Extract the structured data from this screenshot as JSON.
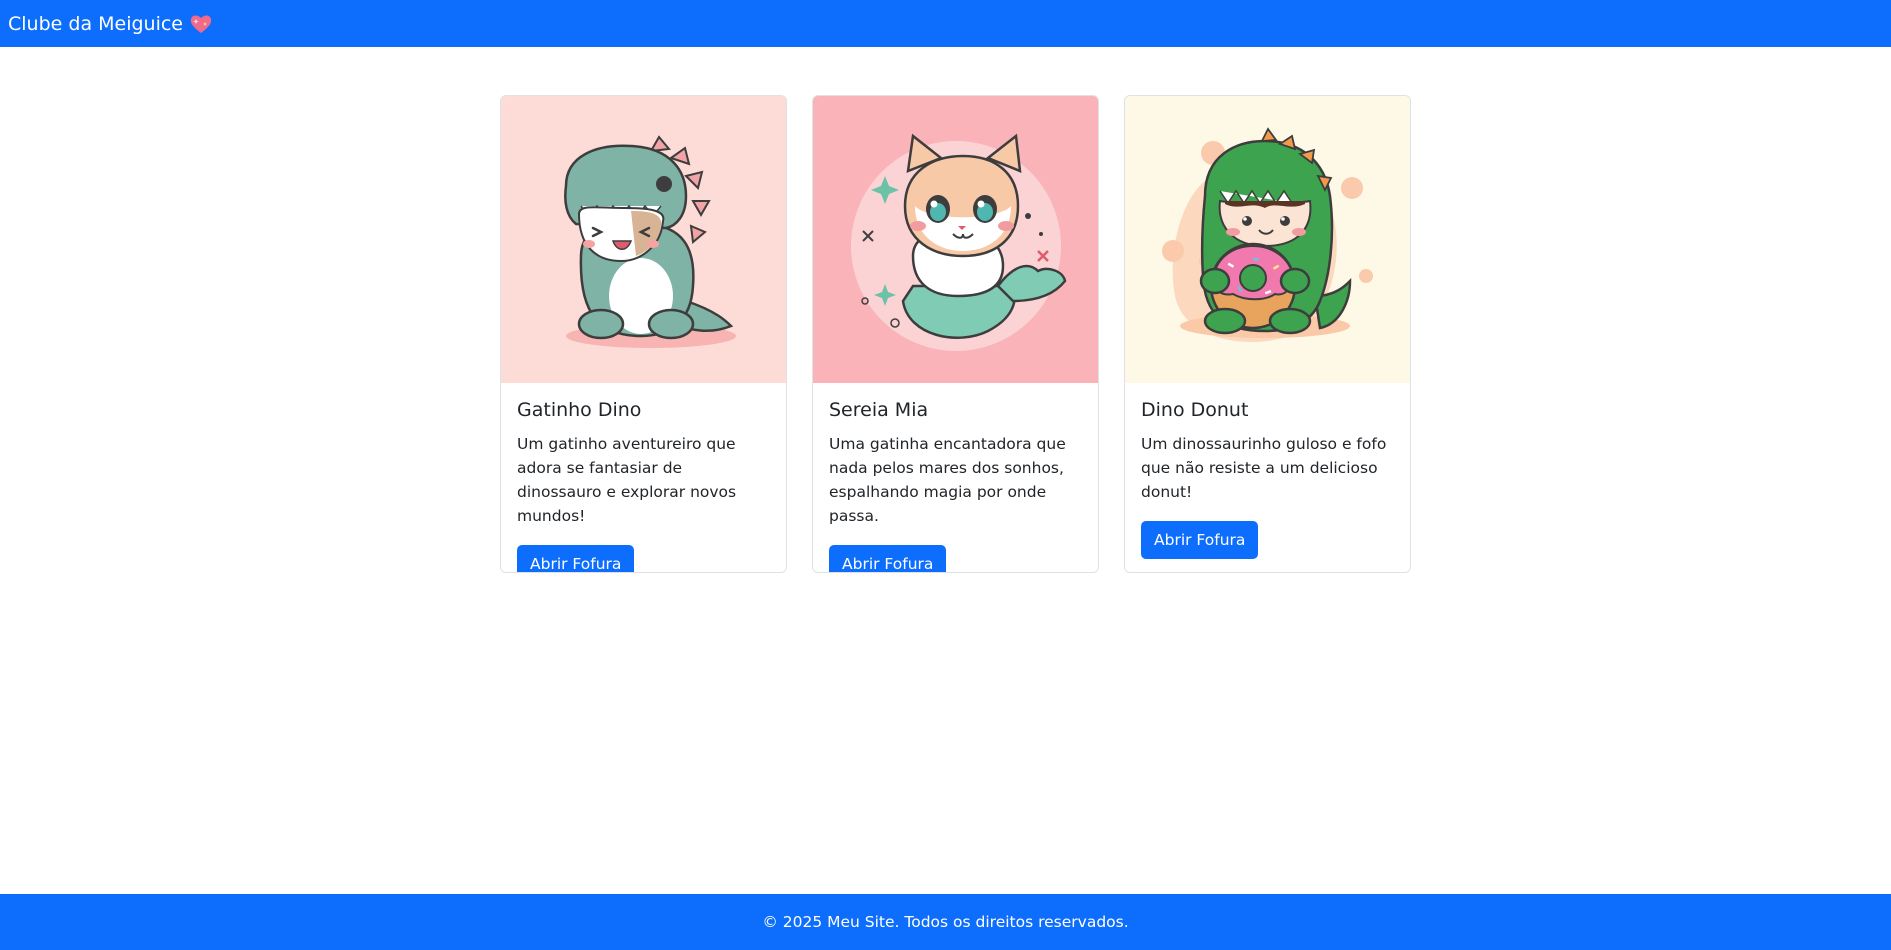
{
  "navbar": {
    "brand": "Clube da Meiguice",
    "brand_icon": "sparkling-heart-icon"
  },
  "cards": [
    {
      "title": "Gatinho Dino",
      "text": "Um gatinho aventureiro que adora se fantasiar de dinossauro e explorar novos mundos!",
      "button": "Abrir Fofura",
      "image_bg": "#fddcd7",
      "image": "cat-in-dino-costume-illustration"
    },
    {
      "title": "Sereia Mia",
      "text": "Uma gatinha encantadora que nada pelos mares dos sonhos, espalhando magia por onde passa.",
      "button": "Abrir Fofura",
      "image_bg": "#f9b3b9",
      "image": "mermaid-cat-illustration"
    },
    {
      "title": "Dino Donut",
      "text": "Um dinossaurinho guloso e fofo que não resiste a um delicioso donut!",
      "button": "Abrir Fofura",
      "image_bg": "#fdf9e6",
      "image": "dino-with-donut-illustration"
    }
  ],
  "footer": {
    "text": "© 2025 Meu Site. Todos os direitos reservados."
  },
  "colors": {
    "primary": "#0d6efd",
    "text": "#212529",
    "border": "#dee2e6"
  }
}
